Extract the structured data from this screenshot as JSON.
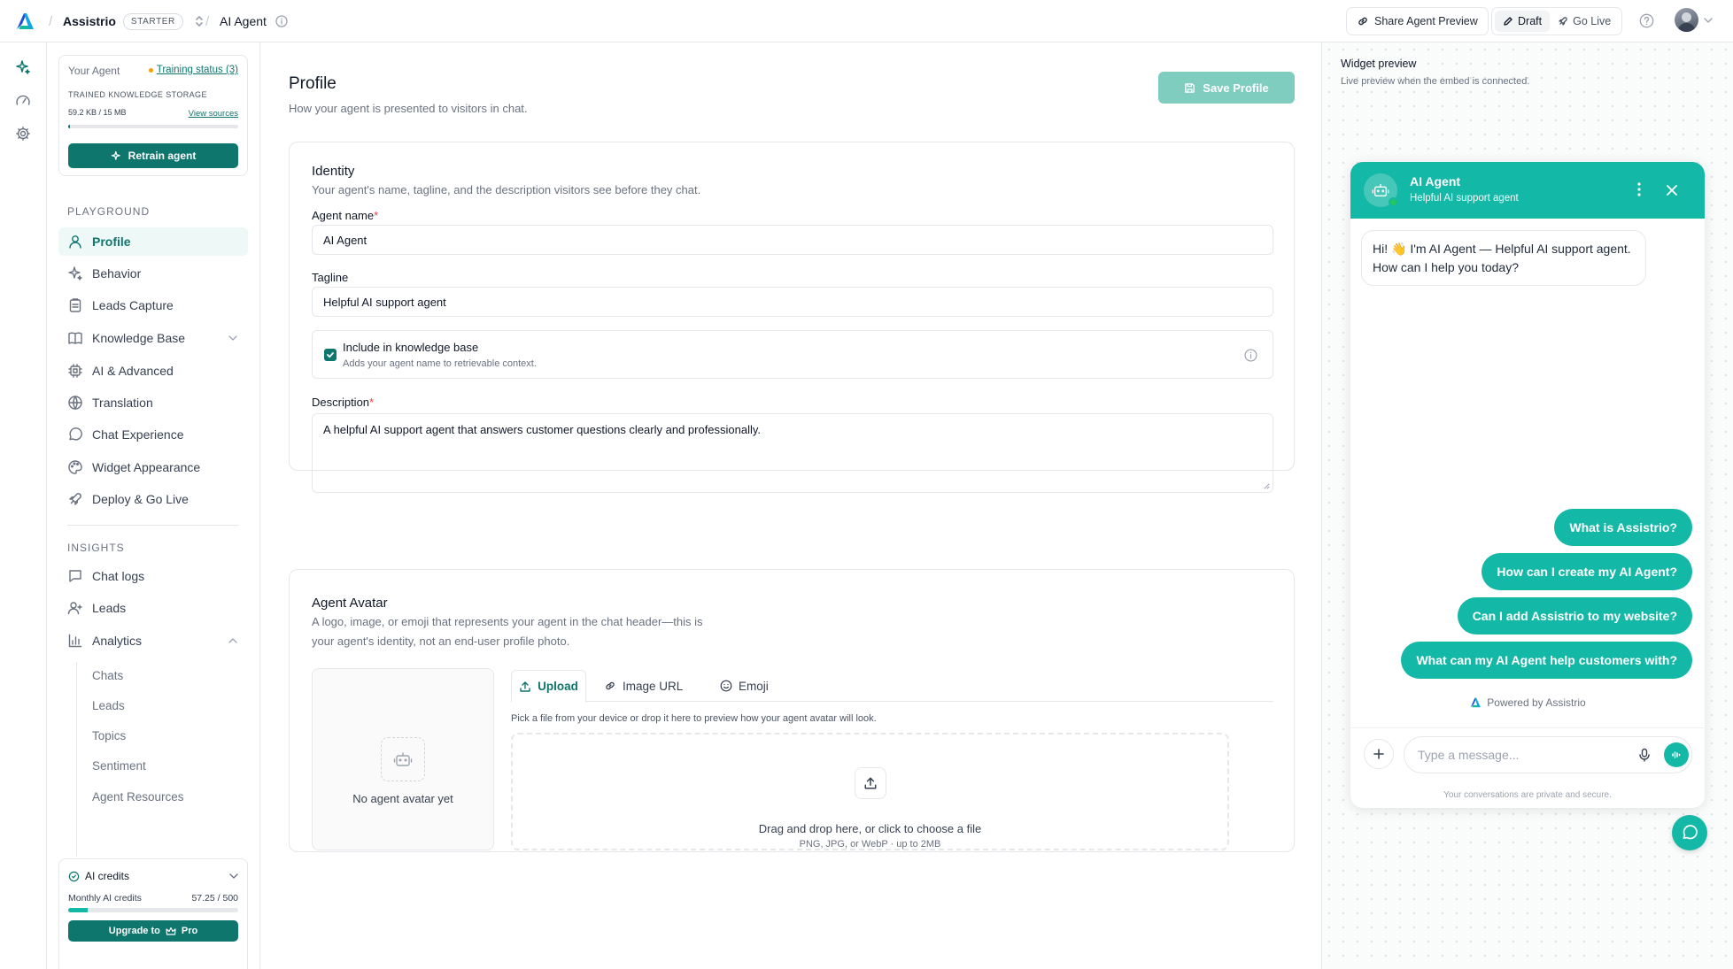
{
  "topbar": {
    "brand": "Assistrio",
    "plan_badge": "STARTER",
    "agent_name": "AI Agent",
    "share_label": "Share Agent Preview",
    "draft_label": "Draft",
    "golive_label": "Go Live"
  },
  "sidebar": {
    "agent_card": {
      "title": "Your Agent",
      "training_status": "Training status (3)",
      "storage_label": "TRAINED KNOWLEDGE STORAGE",
      "storage_value": "59.2 KB / 15 MB",
      "storage_fraction": 0.004,
      "view_sources": "View sources",
      "retrain_label": "Retrain agent"
    },
    "playground_heading": "PLAYGROUND",
    "playground_items": [
      {
        "label": "Profile"
      },
      {
        "label": "Behavior"
      },
      {
        "label": "Leads Capture"
      },
      {
        "label": "Knowledge Base"
      },
      {
        "label": "AI & Advanced"
      },
      {
        "label": "Translation"
      },
      {
        "label": "Chat Experience"
      },
      {
        "label": "Widget Appearance"
      },
      {
        "label": "Deploy & Go Live"
      }
    ],
    "insights_heading": "INSIGHTS",
    "insights_items": [
      {
        "label": "Chat logs"
      },
      {
        "label": "Leads"
      },
      {
        "label": "Analytics"
      }
    ],
    "analytics_sub": [
      "Chats",
      "Leads",
      "Topics",
      "Sentiment",
      "Agent Resources"
    ],
    "credits": {
      "title": "AI credits",
      "label": "Monthly AI credits",
      "value": "57.25 / 500",
      "fraction": 0.1145,
      "upgrade_prefix": "Upgrade to",
      "upgrade_plan": "Pro"
    }
  },
  "main": {
    "title": "Profile",
    "subtitle": "How your agent is presented to visitors in chat.",
    "save_label": "Save Profile",
    "identity": {
      "title": "Identity",
      "desc": "Your agent's name, tagline, and the description visitors see before they chat.",
      "name_label": "Agent name",
      "name_value": "AI Agent",
      "tagline_label": "Tagline",
      "tagline_value": "Helpful AI support agent",
      "kb_title": "Include in knowledge base",
      "kb_desc": "Adds your agent name to retrievable context.",
      "description_label": "Description",
      "description_value": "A helpful AI support agent that answers customer questions clearly and professionally."
    },
    "avatar": {
      "title": "Agent Avatar",
      "desc_line1": "A logo, image, or emoji that represents your agent in the chat header—this is",
      "desc_line2": "your agent's identity, not an end-user profile photo.",
      "empty_label": "No agent avatar yet",
      "tabs": [
        "Upload",
        "Image URL",
        "Emoji"
      ],
      "hint": "Pick a file from your device or drop it here to preview how your agent avatar will look.",
      "drop_title": "Drag and drop here, or click to choose a file",
      "drop_sub": "PNG, JPG, or WebP · up to 2MB"
    }
  },
  "widget_preview": {
    "title": "Widget preview",
    "subtitle": "Live preview when the embed is connected.",
    "agent_name": "AI Agent",
    "agent_tagline": "Helpful AI support agent",
    "greeting": "Hi! 👋 I'm AI Agent — Helpful AI support agent. How can I help you today?",
    "suggestions": [
      "What is Assistrio?",
      "How can I create my AI Agent?",
      "Can I add Assistrio to my website?",
      "What can my AI Agent help customers with?"
    ],
    "powered_by": "Powered by Assistrio",
    "input_placeholder": "Type a message...",
    "privacy": "Your conversations are private and secure."
  },
  "colors": {
    "accent": "#0f766e",
    "accent_light": "#14b8a6",
    "save_disabled": "#7fcdbf",
    "status_dot": "#f59e0b",
    "required": "#ef4444"
  },
  "icons": {
    "logo": "assistrio-logo",
    "rail": [
      "sparkle-icon",
      "gauge-icon",
      "gear-icon"
    ]
  }
}
